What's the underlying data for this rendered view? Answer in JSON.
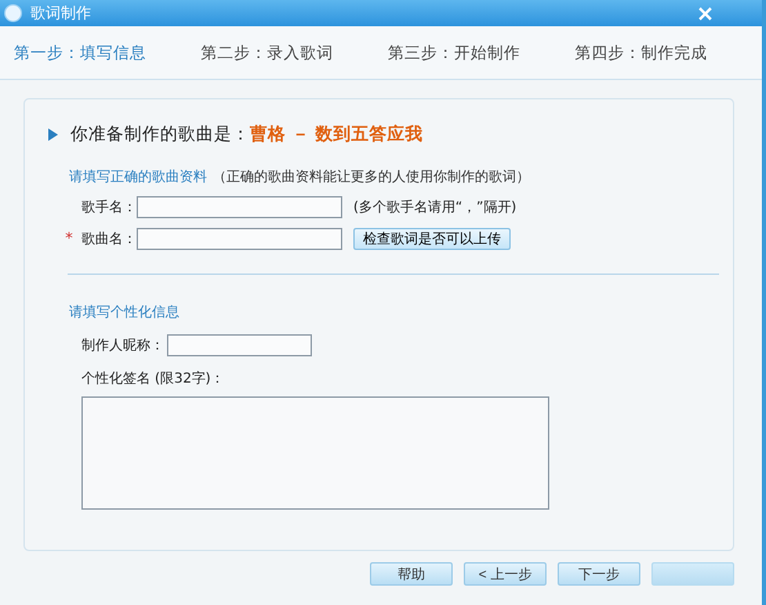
{
  "window": {
    "title": "歌词制作"
  },
  "steps": [
    {
      "label": "第一步：填写信息",
      "selected": true
    },
    {
      "label": "第二步：录入歌词",
      "selected": false
    },
    {
      "label": "第三步：开始制作",
      "selected": false
    },
    {
      "label": "第四步：制作完成",
      "selected": false
    }
  ],
  "heading": {
    "prefix": "你准备制作的歌曲是：",
    "song": "曹格 － 数到五答应我"
  },
  "song_section": {
    "title": "请填写正确的歌曲资料",
    "note": "（正确的歌曲资料能让更多的人使用你制作的歌词）",
    "fields": [
      {
        "label": "歌手名：",
        "hint": "(多个歌手名请用“，”隔开)"
      },
      {
        "mark": "*",
        "label": "歌曲名：",
        "button": "检查歌词是否可以上传"
      }
    ]
  },
  "personal_section": {
    "title": "请填写个性化信息",
    "nickname_label": "制作人昵称：",
    "signature_label": "个性化签名 (限32字)："
  },
  "buttons": [
    {
      "kind": "text",
      "label": "帮助"
    },
    {
      "kind": "text",
      "label": "< 上一步"
    },
    {
      "kind": "text",
      "label": "下一步"
    },
    {
      "kind": "blank"
    }
  ]
}
